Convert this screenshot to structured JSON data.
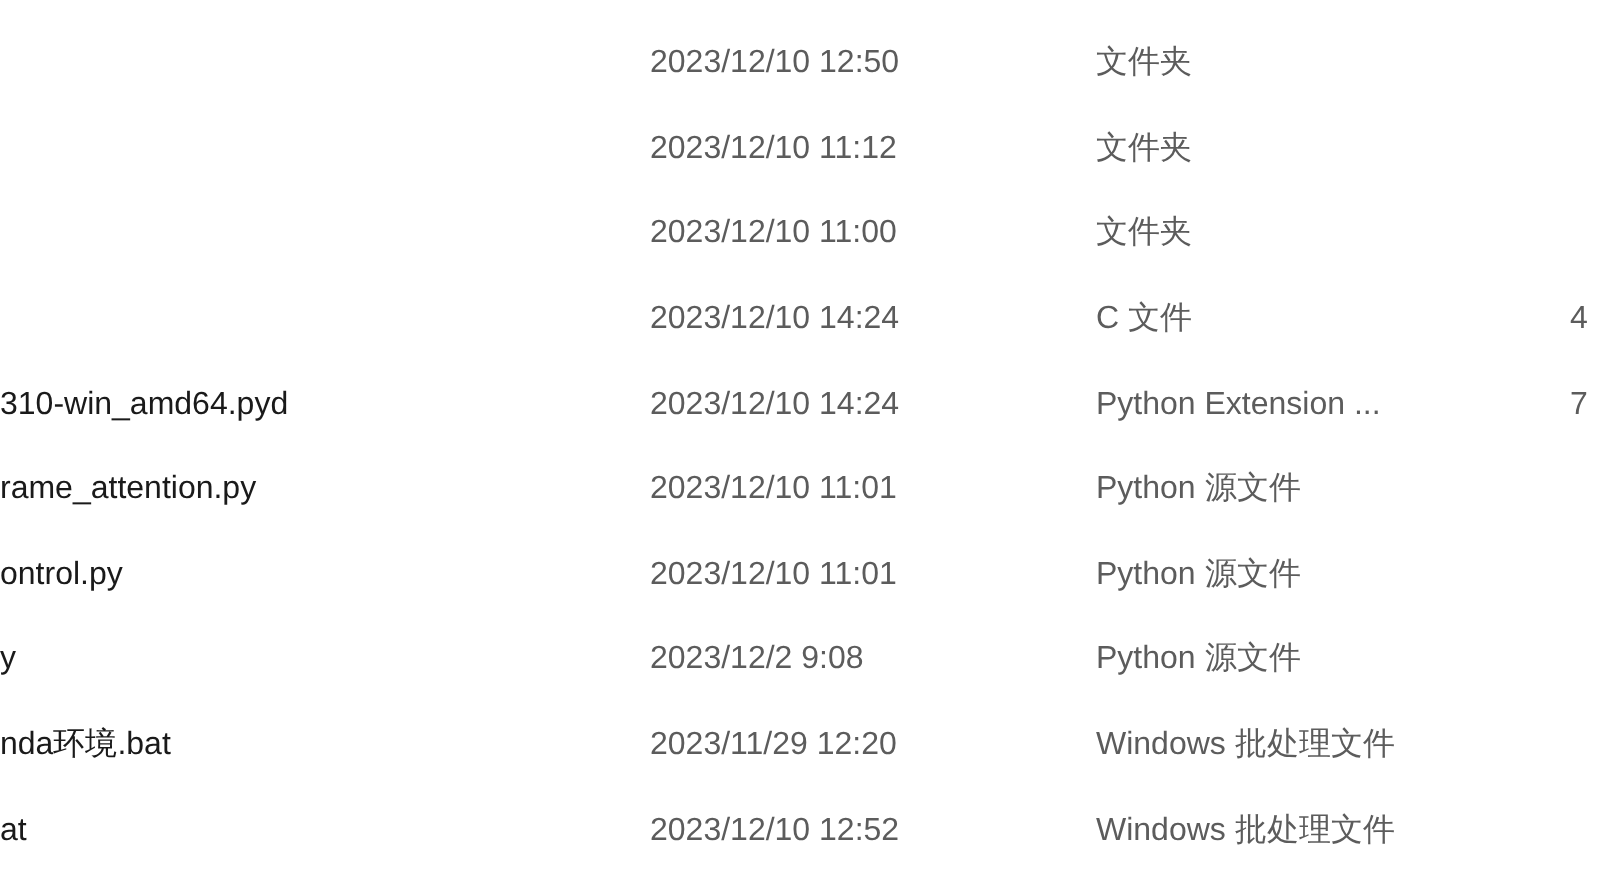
{
  "files": [
    {
      "modified": "2023/12/10 12:50",
      "type": "文件夹"
    },
    {
      "modified": "2023/12/10 11:12",
      "type": "文件夹"
    },
    {
      "modified": "2023/12/10 11:00",
      "type": "文件夹"
    },
    {
      "modified": "2023/12/10 14:24",
      "type": "C 文件",
      "size": "4"
    },
    {
      "name": "310-win_amd64.pyd",
      "modified": "2023/12/10 14:24",
      "type": "Python Extension ...",
      "size": "7"
    },
    {
      "name": "rame_attention.py",
      "modified": "2023/12/10 11:01",
      "type": "Python 源文件"
    },
    {
      "name": "ontrol.py",
      "modified": "2023/12/10 11:01",
      "type": "Python 源文件"
    },
    {
      "name": "y",
      "modified": "2023/12/2 9:08",
      "type": "Python 源文件"
    },
    {
      "name": "nda环境.bat",
      "modified": "2023/11/29 12:20",
      "type": "Windows 批处理文件"
    },
    {
      "name": "at",
      "modified": "2023/12/10 12:52",
      "type": "Windows 批处理文件"
    }
  ]
}
